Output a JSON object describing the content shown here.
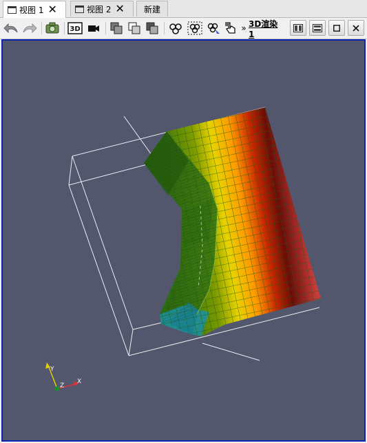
{
  "tabs": [
    {
      "label": "视图 1",
      "active": true
    },
    {
      "label": "视图 2",
      "active": false
    },
    {
      "label": "新建",
      "active": false
    }
  ],
  "toolbar": {
    "overflow": "»",
    "view_name": "3D渲染1",
    "icons": [
      "undo-camera-icon",
      "redo-camera-icon",
      "capture-screenshot-icon",
      "3d-toggle-icon",
      "record-camera-icon",
      "select-cells-on-icon",
      "select-points-on-icon",
      "select-cells-through-icon",
      "select-block-icon",
      "interactive-select-icon",
      "hover-points-icon",
      "hover-cells-icon",
      "split-horizontal-icon",
      "split-vertical-icon",
      "maximize-icon",
      "close-icon"
    ]
  },
  "render": {
    "background": "#52576e",
    "colormap": [
      "#1e8f9c",
      "#2a6e10",
      "#7d9a00",
      "#e8d200",
      "#ff9a00",
      "#c82800",
      "#6a0d08",
      "#c83c3c"
    ],
    "orientation_axes": {
      "x": "X",
      "y": "Y",
      "z": "Z"
    }
  }
}
